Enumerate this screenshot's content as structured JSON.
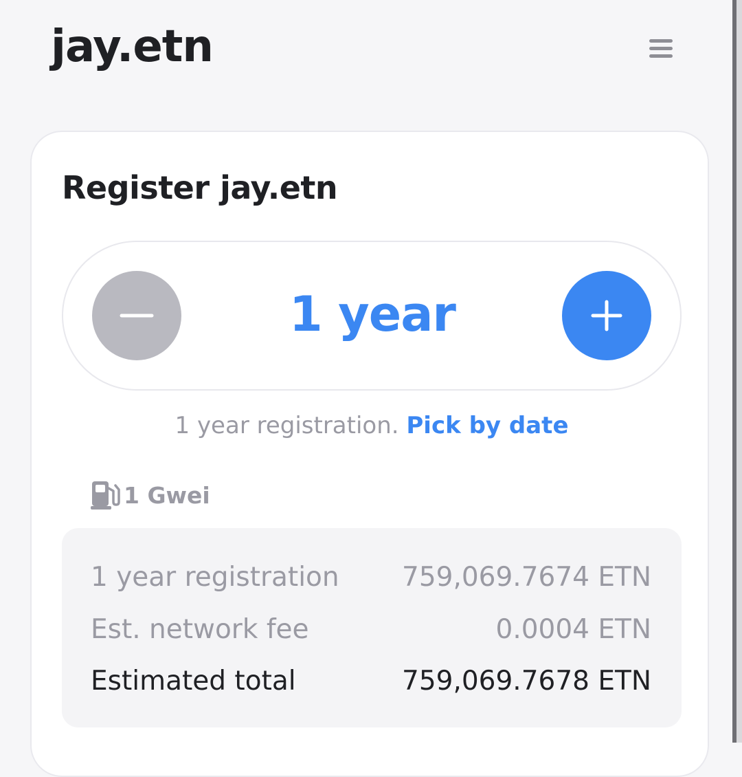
{
  "header": {
    "brand": "jay.etn",
    "menu_icon": "hamburger-menu-icon"
  },
  "card": {
    "title": "Register jay.etn",
    "stepper": {
      "minus_icon": "minus-icon",
      "plus_icon": "plus-icon",
      "value": "1 year",
      "minus_enabled": false,
      "plus_enabled": true
    },
    "duration_note": {
      "text": "1 year registration.",
      "link": "Pick by date"
    },
    "gas": {
      "icon": "gas-pump-icon",
      "label": "1 Gwei"
    },
    "summary": [
      {
        "label": "1 year registration",
        "value": "759,069.7674 ETN"
      },
      {
        "label": "Est. network fee",
        "value": "0.0004 ETN"
      },
      {
        "label": "Estimated total",
        "value": "759,069.7678 ETN"
      }
    ]
  },
  "colors": {
    "accent": "#3b87f2",
    "disabled": "#b9b9c0",
    "muted_text": "#9a9aa3",
    "dark_text": "#1f2024"
  }
}
